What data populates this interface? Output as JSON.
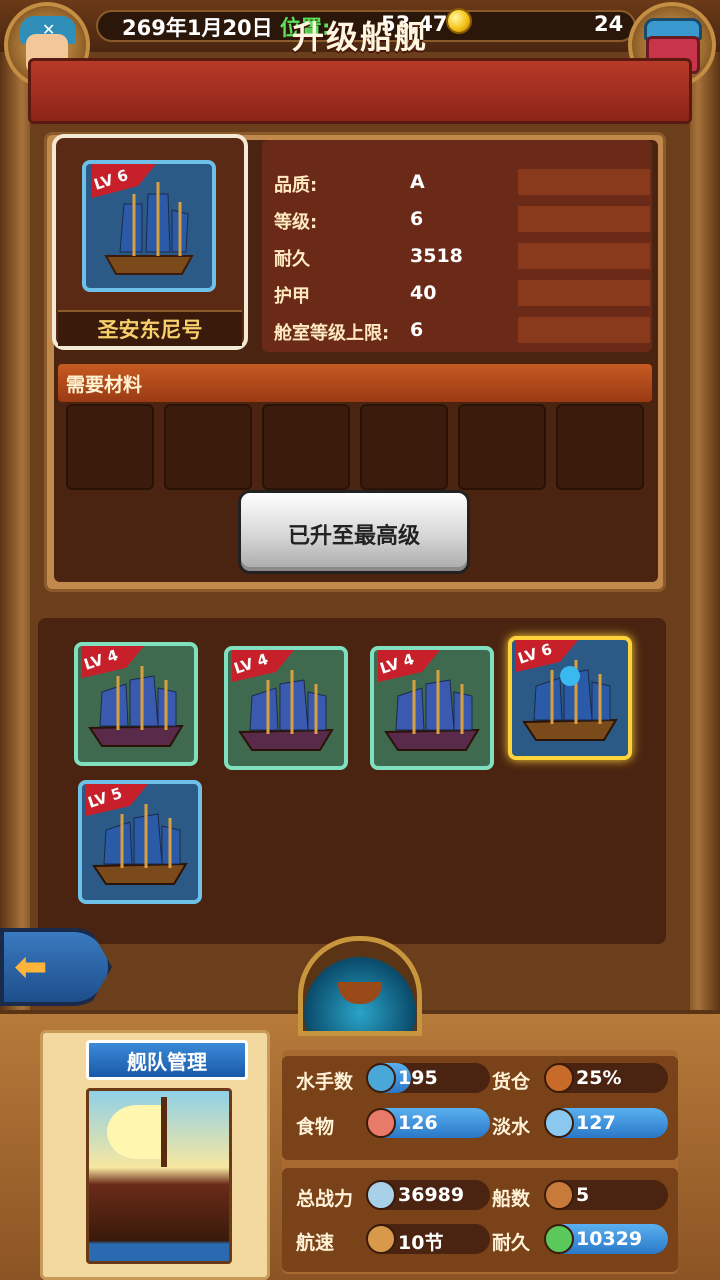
{
  "topbar": {
    "date": "269年1月20日",
    "position_label": "位置:",
    "position_value": "53,47",
    "gem_count": "24"
  },
  "title": "升级船舰",
  "ship": {
    "name": "圣安东尼号",
    "level_label": "LV 6"
  },
  "stats": [
    {
      "label": "品质:",
      "value": "A"
    },
    {
      "label": "等级:",
      "value": "6"
    },
    {
      "label": "耐久",
      "value": "3518"
    },
    {
      "label": "护甲",
      "value": "40"
    },
    {
      "label": "舱室等级上限:",
      "value": "6"
    }
  ],
  "materials": {
    "title": "需要材料",
    "slot_count": 6
  },
  "maxed_button": "已升至最高级",
  "fleet": [
    {
      "level": "LV 4",
      "style": "green"
    },
    {
      "level": "LV 4",
      "style": "green"
    },
    {
      "level": "LV 4",
      "style": "green"
    },
    {
      "level": "LV 6",
      "style": "selected"
    },
    {
      "level": "LV 5",
      "style": "blue"
    }
  ],
  "bottom": {
    "fleet_title": "舰队管理",
    "sailors_label": "水手数",
    "sailors_value": "195",
    "cargo_label": "货仓",
    "cargo_value": "25%",
    "food_label": "食物",
    "food_value": "126",
    "water_label": "淡水",
    "water_value": "127",
    "power_label": "总战力",
    "power_value": "36989",
    "ships_label": "船数",
    "ships_value": "5",
    "speed_label": "航速",
    "speed_value": "10节",
    "durability_label": "耐久",
    "durability_value": "10329"
  },
  "colors": {
    "title_red": "#b83a28",
    "position_green": "#5ee05a",
    "selected_gold": "#ffd33a",
    "value_blue": "#2a78c8"
  }
}
